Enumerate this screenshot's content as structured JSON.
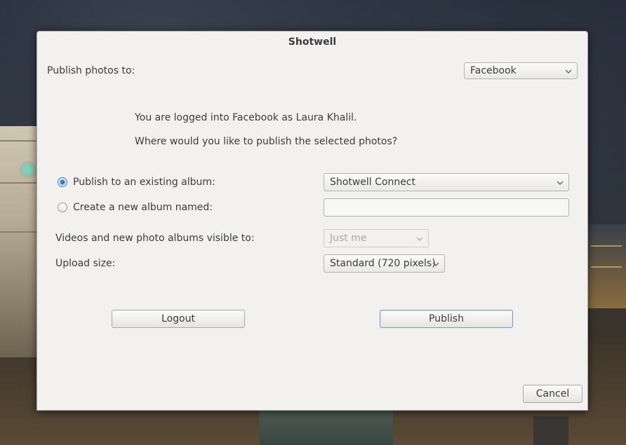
{
  "window": {
    "title": "Shotwell"
  },
  "publish_to": {
    "label": "Publish photos to:",
    "service": "Facebook"
  },
  "info": {
    "logged_in": "You are logged into Facebook as Laura Khalil.",
    "question": "Where would you like to publish the selected photos?"
  },
  "existing_album": {
    "label": "Publish to an existing album:",
    "selected": "Shotwell Connect",
    "checked": true
  },
  "new_album": {
    "label": "Create a new album named:",
    "value": "",
    "checked": false
  },
  "visibility": {
    "label": "Videos and new photo albums visible to:",
    "value": "Just me"
  },
  "upload_size": {
    "label": "Upload size:",
    "value": "Standard (720 pixels)"
  },
  "buttons": {
    "logout": "Logout",
    "publish": "Publish",
    "cancel": "Cancel"
  },
  "icons": {
    "dropdown": "chevron-down-icon"
  },
  "colors": {
    "accent": "#3f7cc4",
    "dialog_bg": "#f2f1f0"
  }
}
